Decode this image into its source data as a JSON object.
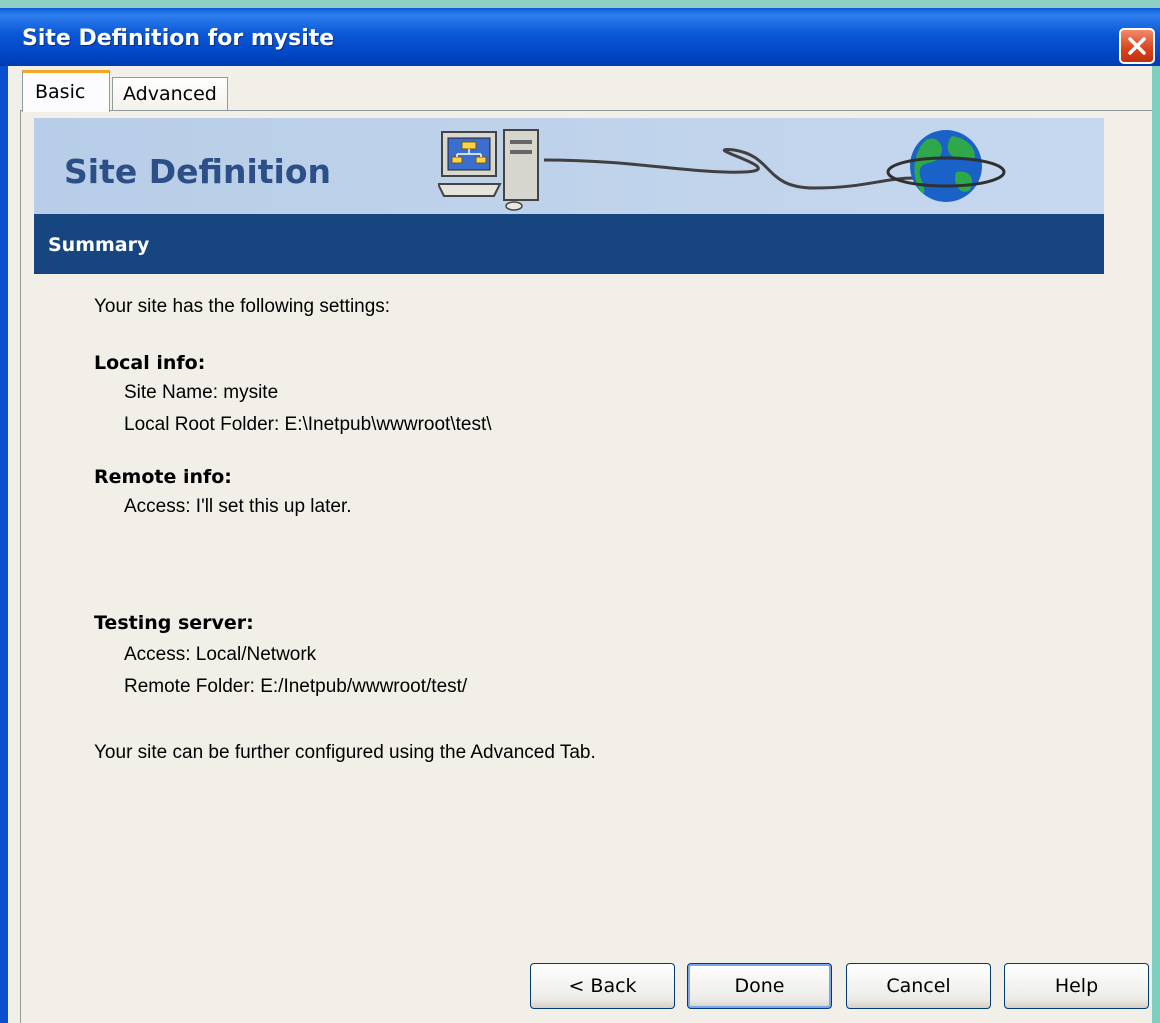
{
  "window": {
    "title": "Site Definition for mysite"
  },
  "tabs": [
    {
      "label": "Basic",
      "active": true
    },
    {
      "label": "Advanced",
      "active": false
    }
  ],
  "banner": {
    "title": "Site Definition"
  },
  "section": {
    "title": "Summary"
  },
  "content": {
    "intro": "Your site has the following settings:",
    "local": {
      "heading": "Local info:",
      "site_name": "Site Name: mysite",
      "root_folder": "Local Root Folder: E:\\Inetpub\\wwwroot\\test\\"
    },
    "remote": {
      "heading": "Remote info:",
      "access": "Access: I'll set this up later."
    },
    "testing": {
      "heading": "Testing server:",
      "access": "Access: Local/Network",
      "remote_folder": "Remote Folder: E:/Inetpub/wwwroot/test/"
    },
    "footer": "Your site can be further configured using the Advanced Tab."
  },
  "buttons": {
    "back": "< Back",
    "done": "Done",
    "cancel": "Cancel",
    "help": "Help"
  },
  "colors": {
    "title_bar": "#0246c4",
    "summary_bar": "#17457f",
    "banner": "#c6d8ef",
    "banner_text": "#2b4f86"
  },
  "icons": [
    "close-icon",
    "computer-icon",
    "globe-icon"
  ]
}
